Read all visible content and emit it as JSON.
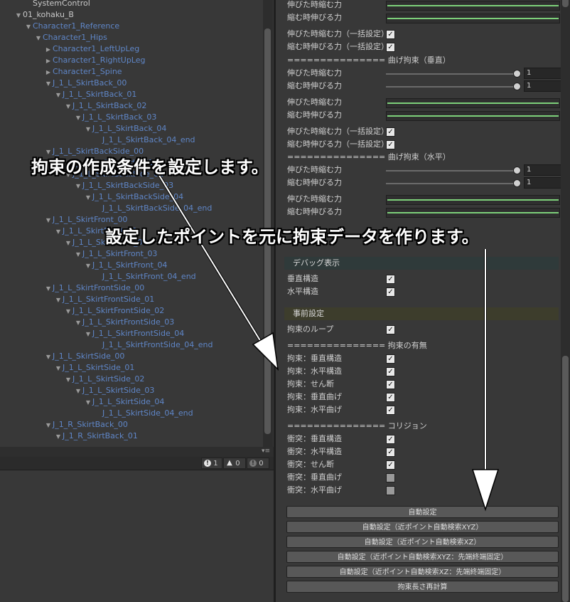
{
  "hierarchy": {
    "rows": [
      {
        "label": "SystemControl",
        "depth": 0,
        "arrow": "",
        "kind": "plain"
      },
      {
        "label": "01_kohaku_B",
        "depth": 0,
        "arrow": "down",
        "kind": "sel"
      },
      {
        "label": "Character1_Reference",
        "depth": 1,
        "arrow": "down",
        "kind": "blue"
      },
      {
        "label": "Character1_Hips",
        "depth": 2,
        "arrow": "down",
        "kind": "blue"
      },
      {
        "label": "Character1_LeftUpLeg",
        "depth": 3,
        "arrow": "right",
        "kind": "blue"
      },
      {
        "label": "Character1_RightUpLeg",
        "depth": 3,
        "arrow": "right",
        "kind": "blue"
      },
      {
        "label": "Character1_Spine",
        "depth": 3,
        "arrow": "right",
        "kind": "blue"
      },
      {
        "label": "J_1_L_SkirtBack_00",
        "depth": 3,
        "arrow": "down",
        "kind": "blue"
      },
      {
        "label": "J_1_L_SkirtBack_01",
        "depth": 4,
        "arrow": "down",
        "kind": "blue"
      },
      {
        "label": "J_1_L_SkirtBack_02",
        "depth": 5,
        "arrow": "down",
        "kind": "blue"
      },
      {
        "label": "J_1_L_SkirtBack_03",
        "depth": 6,
        "arrow": "down",
        "kind": "blue"
      },
      {
        "label": "J_1_L_SkirtBack_04",
        "depth": 7,
        "arrow": "down",
        "kind": "blue"
      },
      {
        "label": "J_1_L_SkirtBack_04_end",
        "depth": 8,
        "arrow": "",
        "kind": "blue"
      },
      {
        "label": "J_1_L_SkirtBackSide_00",
        "depth": 3,
        "arrow": "down",
        "kind": "blue"
      },
      {
        "label": "J_1_L_SkirtBackSide_01",
        "depth": 4,
        "arrow": "down",
        "kind": "blue"
      },
      {
        "label": "J_1_L_SkirtBackSide_02",
        "depth": 5,
        "arrow": "down",
        "kind": "blue"
      },
      {
        "label": "J_1_L_SkirtBackSide_03",
        "depth": 6,
        "arrow": "down",
        "kind": "blue"
      },
      {
        "label": "J_1_L_SkirtBackSide_04",
        "depth": 7,
        "arrow": "down",
        "kind": "blue"
      },
      {
        "label": "J_1_L_SkirtBackSide_04_end",
        "depth": 8,
        "arrow": "",
        "kind": "blue"
      },
      {
        "label": "J_1_L_SkirtFront_00",
        "depth": 3,
        "arrow": "down",
        "kind": "blue"
      },
      {
        "label": "J_1_L_SkirtFront_01",
        "depth": 4,
        "arrow": "down",
        "kind": "blue"
      },
      {
        "label": "J_1_L_SkirtFront_02",
        "depth": 5,
        "arrow": "down",
        "kind": "blue"
      },
      {
        "label": "J_1_L_SkirtFront_03",
        "depth": 6,
        "arrow": "down",
        "kind": "blue"
      },
      {
        "label": "J_1_L_SkirtFront_04",
        "depth": 7,
        "arrow": "down",
        "kind": "blue"
      },
      {
        "label": "J_1_L_SkirtFront_04_end",
        "depth": 8,
        "arrow": "",
        "kind": "blue"
      },
      {
        "label": "J_1_L_SkirtFrontSide_00",
        "depth": 3,
        "arrow": "down",
        "kind": "blue"
      },
      {
        "label": "J_1_L_SkirtFrontSide_01",
        "depth": 4,
        "arrow": "down",
        "kind": "blue"
      },
      {
        "label": "J_1_L_SkirtFrontSide_02",
        "depth": 5,
        "arrow": "down",
        "kind": "blue"
      },
      {
        "label": "J_1_L_SkirtFrontSide_03",
        "depth": 6,
        "arrow": "down",
        "kind": "blue"
      },
      {
        "label": "J_1_L_SkirtFrontSide_04",
        "depth": 7,
        "arrow": "down",
        "kind": "blue"
      },
      {
        "label": "J_1_L_SkirtFrontSide_04_end",
        "depth": 8,
        "arrow": "",
        "kind": "blue"
      },
      {
        "label": "J_1_L_SkirtSide_00",
        "depth": 3,
        "arrow": "down",
        "kind": "blue"
      },
      {
        "label": "J_1_L_SkirtSide_01",
        "depth": 4,
        "arrow": "down",
        "kind": "blue"
      },
      {
        "label": "J_1_L_SkirtSide_02",
        "depth": 5,
        "arrow": "down",
        "kind": "blue"
      },
      {
        "label": "J_1_L_SkirtSide_03",
        "depth": 6,
        "arrow": "down",
        "kind": "blue"
      },
      {
        "label": "J_1_L_SkirtSide_04",
        "depth": 7,
        "arrow": "down",
        "kind": "blue"
      },
      {
        "label": "J_1_L_SkirtSide_04_end",
        "depth": 8,
        "arrow": "",
        "kind": "blue"
      },
      {
        "label": "J_1_R_SkirtBack_00",
        "depth": 3,
        "arrow": "down",
        "kind": "blue"
      },
      {
        "label": "J_1_R_SkirtBack_01",
        "depth": 4,
        "arrow": "down",
        "kind": "blue"
      }
    ]
  },
  "console": {
    "menu_icon": "menu-icon",
    "error_count": "1",
    "warning_count": "0",
    "info_count": "0"
  },
  "inspector": {
    "top_rows": [
      {
        "kind": "green",
        "label": "伸びた時縮む力"
      },
      {
        "kind": "green",
        "label": "縮む時伸びる力"
      },
      {
        "kind": "check",
        "label": "伸びた時縮む力（一括設定）",
        "checked": true
      },
      {
        "kind": "check",
        "label": "縮む時伸びる力（一括設定）",
        "checked": true
      },
      {
        "kind": "sep",
        "label": "=============== 曲げ拘束（垂直）"
      },
      {
        "kind": "slider",
        "label": "伸びた時縮む力",
        "value": "1"
      },
      {
        "kind": "slider",
        "label": "縮む時伸びる力",
        "value": "1"
      },
      {
        "kind": "green",
        "label": "伸びた時縮む力"
      },
      {
        "kind": "green",
        "label": "縮む時伸びる力"
      },
      {
        "kind": "check",
        "label": "伸びた時縮む力（一括設定）",
        "checked": true
      },
      {
        "kind": "check",
        "label": "縮む時伸びる力（一括設定）",
        "checked": true
      },
      {
        "kind": "sep",
        "label": "=============== 曲げ拘束（水平）"
      },
      {
        "kind": "slider",
        "label": "伸びた時縮む力",
        "value": "1"
      },
      {
        "kind": "slider",
        "label": "縮む時伸びる力",
        "value": "1"
      },
      {
        "kind": "green",
        "label": "伸びた時縮む力"
      },
      {
        "kind": "green",
        "label": "縮む時伸びる力"
      }
    ],
    "debug_section": {
      "title": "デバッグ表示",
      "color": "#2f3a3a",
      "rows": [
        {
          "label": "垂直構造",
          "checked": true
        },
        {
          "label": "水平構造",
          "checked": true
        }
      ]
    },
    "pre_section": {
      "title": "事前設定",
      "color": "#3d3d2c",
      "loop_label": "拘束のループ",
      "loop_checked": true,
      "constraint_header": "=============== 拘束の有無",
      "constraint_rows": [
        {
          "label": "拘束：垂直構造",
          "checked": true
        },
        {
          "label": "拘束：水平構造",
          "checked": true
        },
        {
          "label": "拘束：せん断",
          "checked": true
        },
        {
          "label": "拘束：垂直曲げ",
          "checked": true
        },
        {
          "label": "拘束：水平曲げ",
          "checked": true
        }
      ],
      "collision_header": "=============== コリジョン",
      "collision_rows": [
        {
          "label": "衝突：垂直構造",
          "checked": true
        },
        {
          "label": "衝突：水平構造",
          "checked": true
        },
        {
          "label": "衝突：せん断",
          "checked": true
        },
        {
          "label": "衝突：垂直曲げ",
          "checked": false
        },
        {
          "label": "衝突：水平曲げ",
          "checked": false
        }
      ]
    },
    "buttons": [
      "自動設定",
      "自動設定（近ポイント自動検索XYZ）",
      "自動設定（近ポイント自動検索XZ）",
      "自動設定（近ポイント自動検索XYZ：先端終端固定）",
      "自動設定（近ポイント自動検索XZ：先端終端固定）",
      "拘束長さ再計算"
    ]
  },
  "annotations": {
    "note1": "拘束の作成条件を設定します。",
    "note2": "設定したポイントを元に拘束データを作ります。"
  },
  "colors": {
    "accent_blue": "#5f86c7",
    "green_bar": "#7dd07a"
  }
}
